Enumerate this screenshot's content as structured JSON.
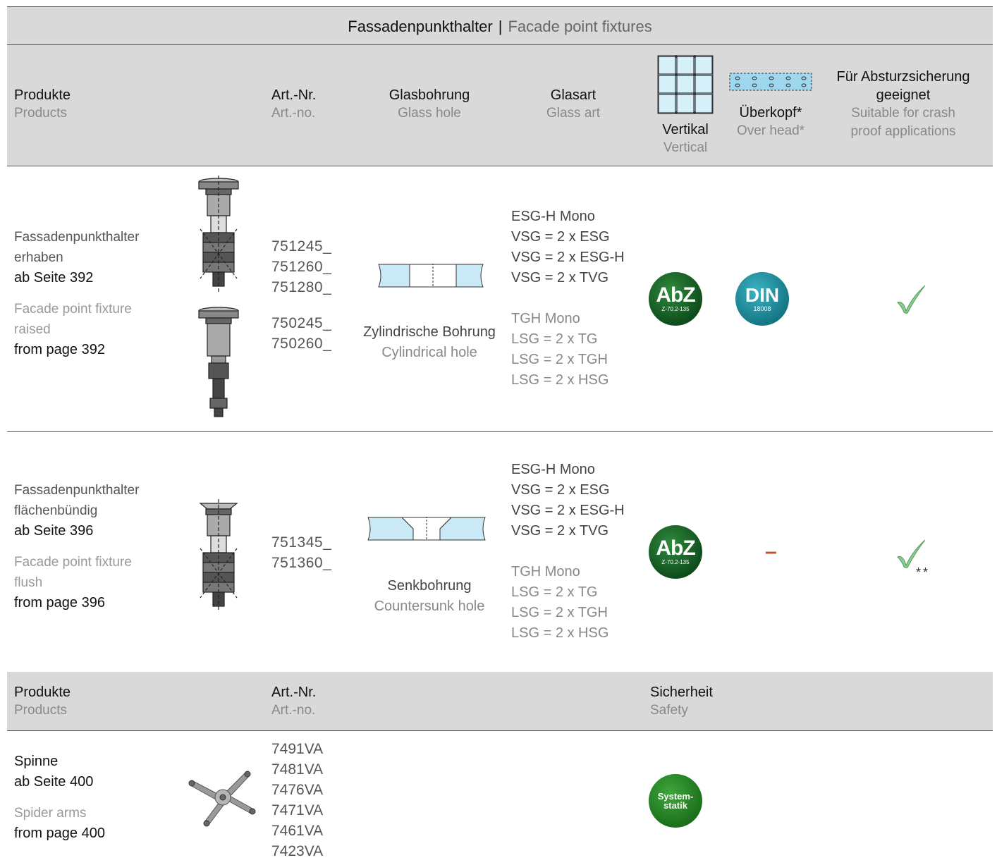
{
  "header": {
    "title_de": "Fassadenpunkthalter",
    "separator": "|",
    "title_en": "Facade point fixtures"
  },
  "columns": {
    "products_de": "Produkte",
    "products_en": "Products",
    "artnr_de": "Art.-Nr.",
    "artnr_en": "Art.-no.",
    "glasshole_de": "Glasbohrung",
    "glasshole_en": "Glass hole",
    "glassart_de": "Glasart",
    "glassart_en": "Glass art",
    "vertical_de": "Vertikal",
    "vertical_en": "Vertical",
    "overhead_de": "Überkopf*",
    "overhead_en": "Over head*",
    "crash_de_1": "Für Absturzsicherung",
    "crash_de_2": "geeignet",
    "crash_en_1": "Suitable for crash",
    "crash_en_2": "proof applications"
  },
  "rows": [
    {
      "name_de_1": "Fassadenpunkthalter",
      "name_de_2": "erhaben",
      "page_de": "ab Seite 392",
      "name_en_1": "Facade point fixture",
      "name_en_2": "raised",
      "page_en": "from page 392",
      "artnr": [
        "751245_",
        "751260_",
        "751280_",
        "750245_",
        "750260_"
      ],
      "hole_de": "Zylindrische Bohrung",
      "hole_en": "Cylindrical hole",
      "glass_de": [
        "ESG-H Mono",
        "VSG = 2 x ESG",
        "VSG = 2 x ESG-H",
        "VSG = 2 x TVG"
      ],
      "glass_en": [
        "TGH Mono",
        "LSG = 2 x TG",
        "LSG = 2 x TGH",
        "LSG = 2 x HSG"
      ],
      "vertical_badge": {
        "main": "AbZ",
        "sub": "Z-70.2-135"
      },
      "overhead_badge": {
        "main": "DIN",
        "sub": "18008"
      },
      "crash": "✓"
    },
    {
      "name_de_1": "Fassadenpunkthalter",
      "name_de_2": "flächenbündig",
      "page_de": "ab Seite 396",
      "name_en_1": "Facade point fixture",
      "name_en_2": "flush",
      "page_en": "from page 396",
      "artnr": [
        "751345_",
        "751360_"
      ],
      "hole_de": "Senkbohrung",
      "hole_en": "Countersunk hole",
      "glass_de": [
        "ESG-H Mono",
        "VSG = 2 x ESG",
        "VSG = 2 x ESG-H",
        "VSG = 2 x TVG"
      ],
      "glass_en": [
        "TGH Mono",
        "LSG = 2 x TG",
        "LSG = 2 x TGH",
        "LSG = 2 x HSG"
      ],
      "vertical_badge": {
        "main": "AbZ",
        "sub": "Z-70.2-135"
      },
      "overhead": "–",
      "crash": "✓",
      "crash_note": "**"
    }
  ],
  "section2": {
    "products_de": "Produkte",
    "products_en": "Products",
    "artnr_de": "Art.-Nr.",
    "artnr_en": "Art.-no.",
    "safety_de": "Sicherheit",
    "safety_en": "Safety"
  },
  "spider": {
    "name_de": "Spinne",
    "page_de": "ab Seite 400",
    "name_en": "Spider arms",
    "page_en": "from page 400",
    "artnr": [
      "7491VA",
      "7481VA",
      "7476VA",
      "7471VA",
      "7461VA",
      "7423VA"
    ],
    "badge_1": "System-",
    "badge_2": "statik"
  },
  "colors": {
    "header_band": "#d9d9d9",
    "abz_green": "#1f6b2c",
    "din_teal": "#2296a5",
    "system_green": "#2e8a2c",
    "check_green": "#7bbf84",
    "dash_red": "#c84f2a"
  }
}
